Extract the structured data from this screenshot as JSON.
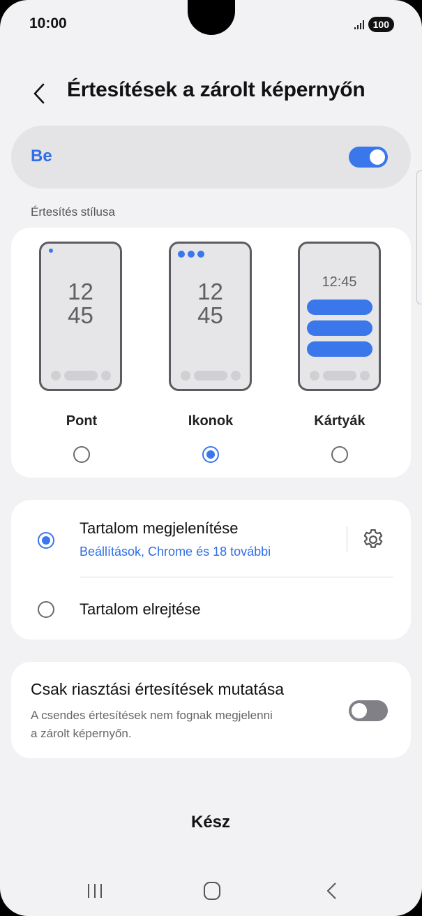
{
  "status_bar": {
    "time": "10:00",
    "battery": "100"
  },
  "header": {
    "title": "Értesítések a zárolt képernyőn"
  },
  "master_toggle": {
    "label": "Be",
    "on": true
  },
  "style_section": {
    "label": "Értesítés stílusa",
    "options": [
      {
        "label": "Pont",
        "selected": false
      },
      {
        "label": "Ikonok",
        "selected": true
      },
      {
        "label": "Kártyák",
        "selected": false
      }
    ],
    "preview": {
      "hour": "12",
      "minute": "45",
      "time_inline": "12:45"
    }
  },
  "content_options": {
    "show": {
      "title": "Tartalom megjelenítése",
      "subtitle": "Beállítások, Chrome és 18 további",
      "selected": true
    },
    "hide": {
      "title": "Tartalom elrejtése",
      "selected": false
    }
  },
  "alert_only": {
    "title": "Csak riasztási értesítések mutatása",
    "description": "A csendes értesítések nem fognak megjelenni a zárolt képernyőn.",
    "on": false
  },
  "footer": {
    "done_label": "Kész"
  },
  "colors": {
    "accent": "#3a77ea",
    "background": "#f2f2f4",
    "card": "#ffffff"
  }
}
